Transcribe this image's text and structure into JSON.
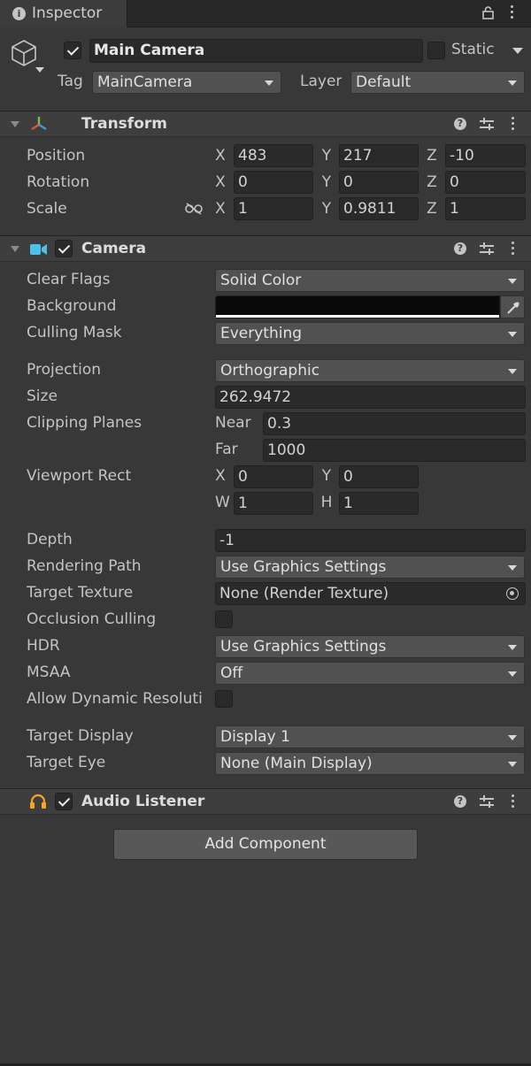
{
  "tab": {
    "title": "Inspector"
  },
  "gameobject": {
    "name": "Main Camera",
    "static_label": "Static",
    "tag_label": "Tag",
    "tag_value": "MainCamera",
    "layer_label": "Layer",
    "layer_value": "Default"
  },
  "transform": {
    "title": "Transform",
    "position": {
      "label": "Position",
      "x": "483",
      "y": "217",
      "z": "-10"
    },
    "rotation": {
      "label": "Rotation",
      "x": "0",
      "y": "0",
      "z": "0"
    },
    "scale": {
      "label": "Scale",
      "x": "1",
      "y": "0.9811",
      "z": "1"
    },
    "axis": {
      "x": "X",
      "y": "Y",
      "z": "Z"
    }
  },
  "camera": {
    "title": "Camera",
    "clear_flags": {
      "label": "Clear Flags",
      "value": "Solid Color"
    },
    "background": {
      "label": "Background",
      "color": "#0a0a0a"
    },
    "culling_mask": {
      "label": "Culling Mask",
      "value": "Everything"
    },
    "projection": {
      "label": "Projection",
      "value": "Orthographic"
    },
    "size": {
      "label": "Size",
      "value": "262.9472"
    },
    "clipping": {
      "label": "Clipping Planes",
      "near_label": "Near",
      "near": "0.3",
      "far_label": "Far",
      "far": "1000"
    },
    "viewport": {
      "label": "Viewport Rect",
      "x_label": "X",
      "x": "0",
      "y_label": "Y",
      "y": "0",
      "w_label": "W",
      "w": "1",
      "h_label": "H",
      "h": "1"
    },
    "depth": {
      "label": "Depth",
      "value": "-1"
    },
    "rendering_path": {
      "label": "Rendering Path",
      "value": "Use Graphics Settings"
    },
    "target_texture": {
      "label": "Target Texture",
      "value": "None (Render Texture)"
    },
    "occlusion": {
      "label": "Occlusion Culling"
    },
    "hdr": {
      "label": "HDR",
      "value": "Use Graphics Settings"
    },
    "msaa": {
      "label": "MSAA",
      "value": "Off"
    },
    "dynamic_res": {
      "label": "Allow Dynamic Resoluti"
    },
    "target_display": {
      "label": "Target Display",
      "value": "Display 1"
    },
    "target_eye": {
      "label": "Target Eye",
      "value": "None (Main Display)"
    }
  },
  "audio_listener": {
    "title": "Audio Listener"
  },
  "add_component": {
    "label": "Add Component"
  },
  "colors": {
    "accent_cyan": "#4fc1e9",
    "audio_orange": "#f5a623",
    "bg": "#383838"
  }
}
